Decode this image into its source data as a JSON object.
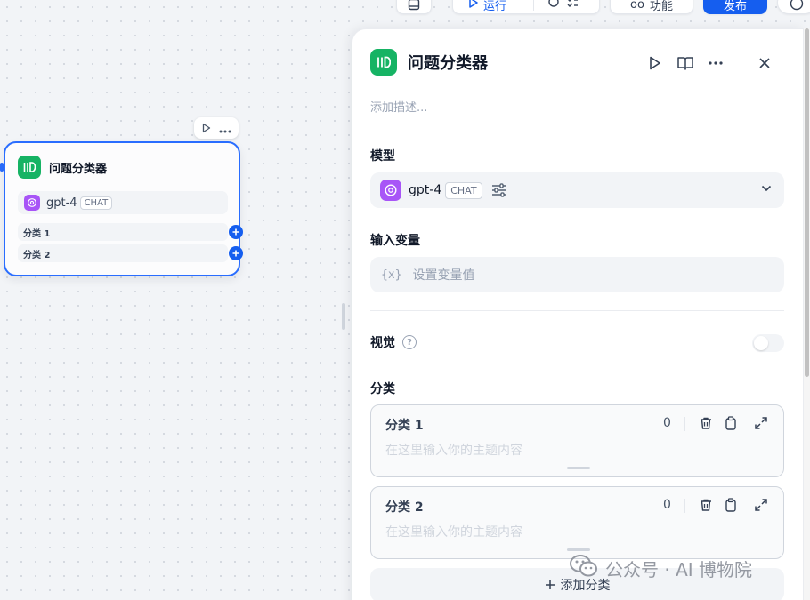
{
  "toolbar": {
    "run_label": "运行",
    "features_label": "功能",
    "publish_label": "发布"
  },
  "node": {
    "title": "问题分类器",
    "model_name": "gpt-4",
    "model_mode": "CHAT",
    "classes": [
      "分类 1",
      "分类 2"
    ]
  },
  "panel": {
    "title": "问题分类器",
    "description_placeholder": "添加描述...",
    "model_section_label": "模型",
    "model_name": "gpt-4",
    "model_mode": "CHAT",
    "input_section_label": "输入变量",
    "input_symbol": "{x}",
    "input_placeholder": "设置变量值",
    "vision_label": "视觉",
    "vision_enabled": false,
    "classes_section_label": "分类",
    "classes": [
      {
        "name": "分类 1",
        "count": "0",
        "placeholder": "在这里输入你的主题内容"
      },
      {
        "name": "分类 2",
        "count": "0",
        "placeholder": "在这里输入你的主题内容"
      }
    ],
    "add_class_label": "添加分类"
  },
  "watermark": {
    "text": "公众号 · AI 博物院"
  },
  "colors": {
    "accent": "#155eef",
    "node_border": "#296dff",
    "app_icon": "#16b364",
    "gpt_icon": "#a855f7"
  }
}
